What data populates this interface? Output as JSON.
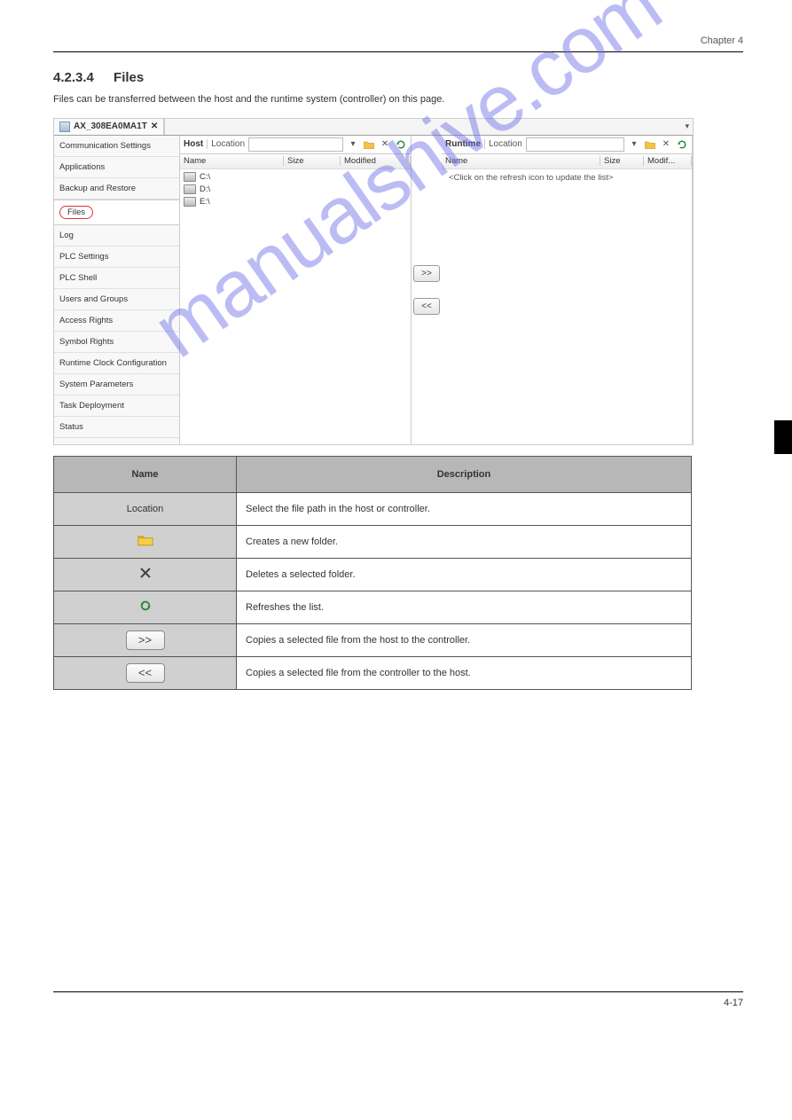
{
  "header": {
    "right": "Chapter 4"
  },
  "section": {
    "number": "4.2.3.4",
    "title": "Files",
    "intro": "Files can be transferred between the host and the runtime system (controller) on this page."
  },
  "screenshot": {
    "tab_title": "AX_308EA0MA1T",
    "sidebar": [
      "Communication Settings",
      "Applications",
      "Backup and Restore",
      "Files",
      "Log",
      "PLC Settings",
      "PLC Shell",
      "Users and Groups",
      "Access Rights",
      "Symbol Rights",
      "Runtime Clock Configuration",
      "System Parameters",
      "Task Deployment",
      "Status"
    ],
    "host_label": "Host",
    "runtime_label": "Runtime",
    "location_label": "Location",
    "columns": {
      "name": "Name",
      "size": "Size",
      "modified": "Modified",
      "modified_short": "Modif..."
    },
    "drives": [
      "C:\\",
      "D:\\",
      "E:\\"
    ],
    "runtime_placeholder": "<Click on the refresh icon to update the list>",
    "to_right": ">>",
    "to_left": "<<"
  },
  "table": {
    "hdr_name": "Name",
    "hdr_desc": "Description",
    "row_location": {
      "name": "Location",
      "desc": "Select the file path in the host or controller."
    },
    "row_folder": {
      "desc": "Creates a new folder."
    },
    "row_delete": {
      "desc": "Deletes a selected folder."
    },
    "row_refresh": {
      "desc": "Refreshes the list."
    },
    "row_toctrl": {
      "icon": ">>",
      "desc": "Copies a selected file from the host to the controller."
    },
    "row_tohost": {
      "icon": "<<",
      "desc": "Copies a selected file from the controller to the host."
    }
  },
  "watermark": "manualshive.com",
  "footer": {
    "page": "4-17"
  }
}
